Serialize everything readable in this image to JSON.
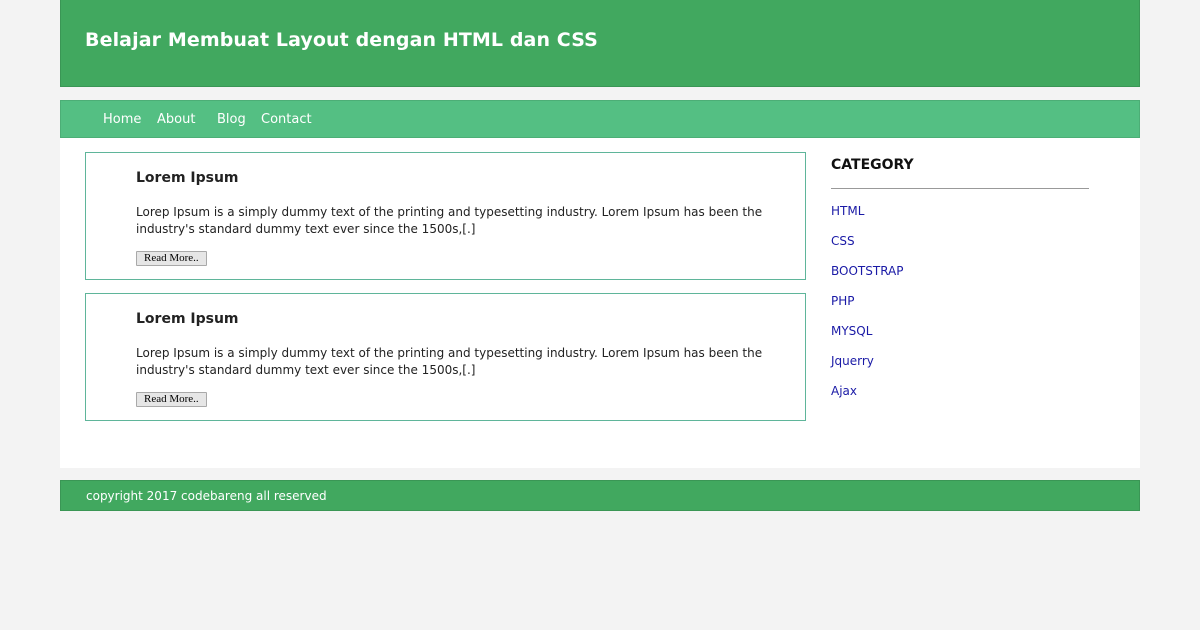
{
  "header": {
    "title": "Belajar Membuat Layout dengan HTML dan CSS"
  },
  "nav": {
    "items": [
      "Home",
      "About",
      "Blog",
      "Contact"
    ]
  },
  "articles": [
    {
      "title": "Lorem Ipsum",
      "text": "Lorep Ipsum is a simply dummy text of the printing and typesetting industry. Lorem Ipsum has been the industry's standard dummy text ever since the 1500s,[.]",
      "button_label": "Read More.."
    },
    {
      "title": "Lorem Ipsum",
      "text": "Lorep Ipsum is a simply dummy text of the printing and typesetting industry. Lorem Ipsum has been the industry's standard dummy text ever since the 1500s,[.]",
      "button_label": "Read More.."
    }
  ],
  "sidebar": {
    "title": "CATEGORY",
    "categories": [
      "HTML",
      "CSS",
      "BOOTSTRAP",
      "PHP",
      "MYSQL",
      "Jquerry",
      "Ajax"
    ]
  },
  "footer": {
    "copyright": "copyright 2017 codebareng all reserved"
  },
  "colors": {
    "header_bg": "#41a85f",
    "nav_bg": "#54bf83",
    "link": "#1a1aa6",
    "article_border": "#5fb59a"
  }
}
